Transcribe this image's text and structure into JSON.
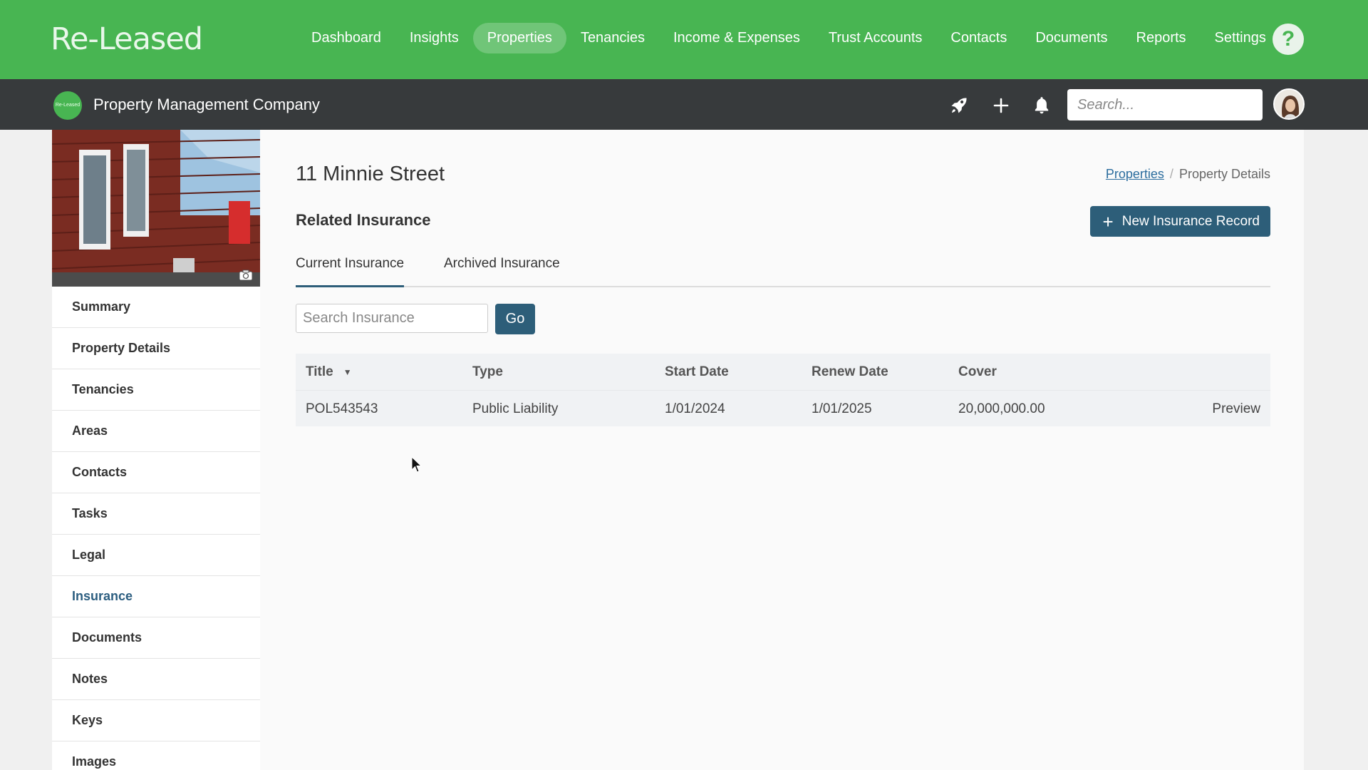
{
  "brand": {
    "logo_text": "Re-Leased",
    "small_logo_text": "Re-Leased",
    "accent": "#48b552"
  },
  "topnav": {
    "items": [
      {
        "label": "Dashboard"
      },
      {
        "label": "Insights"
      },
      {
        "label": "Properties",
        "active": true
      },
      {
        "label": "Tenancies"
      },
      {
        "label": "Income & Expenses"
      },
      {
        "label": "Trust Accounts"
      },
      {
        "label": "Contacts"
      },
      {
        "label": "Documents"
      },
      {
        "label": "Reports"
      },
      {
        "label": "Settings"
      }
    ],
    "help_label": "?"
  },
  "subbar": {
    "company": "Property Management Company",
    "search_placeholder": "Search...",
    "icons": [
      "rocket-icon",
      "plus-icon",
      "bell-icon"
    ]
  },
  "sidebar": {
    "items": [
      {
        "label": "Summary"
      },
      {
        "label": "Property Details"
      },
      {
        "label": "Tenancies"
      },
      {
        "label": "Areas"
      },
      {
        "label": "Contacts"
      },
      {
        "label": "Tasks"
      },
      {
        "label": "Legal"
      },
      {
        "label": "Insurance",
        "active": true
      },
      {
        "label": "Documents"
      },
      {
        "label": "Notes"
      },
      {
        "label": "Keys"
      },
      {
        "label": "Images"
      }
    ]
  },
  "main": {
    "title": "11 Minnie Street",
    "breadcrumb": {
      "link": "Properties",
      "separator": "/",
      "current": "Property Details"
    },
    "section_title": "Related Insurance",
    "new_button": "New Insurance Record",
    "tabs": [
      {
        "label": "Current Insurance",
        "active": true
      },
      {
        "label": "Archived Insurance"
      }
    ],
    "search_placeholder": "Search Insurance",
    "go_label": "Go",
    "table": {
      "columns": [
        "Title",
        "Type",
        "Start Date",
        "Renew Date",
        "Cover"
      ],
      "rows": [
        {
          "title": "POL543543",
          "type": "Public Liability",
          "start": "1/01/2024",
          "renew": "1/01/2025",
          "cover": "20,000,000.00",
          "action": "Preview"
        }
      ]
    }
  }
}
